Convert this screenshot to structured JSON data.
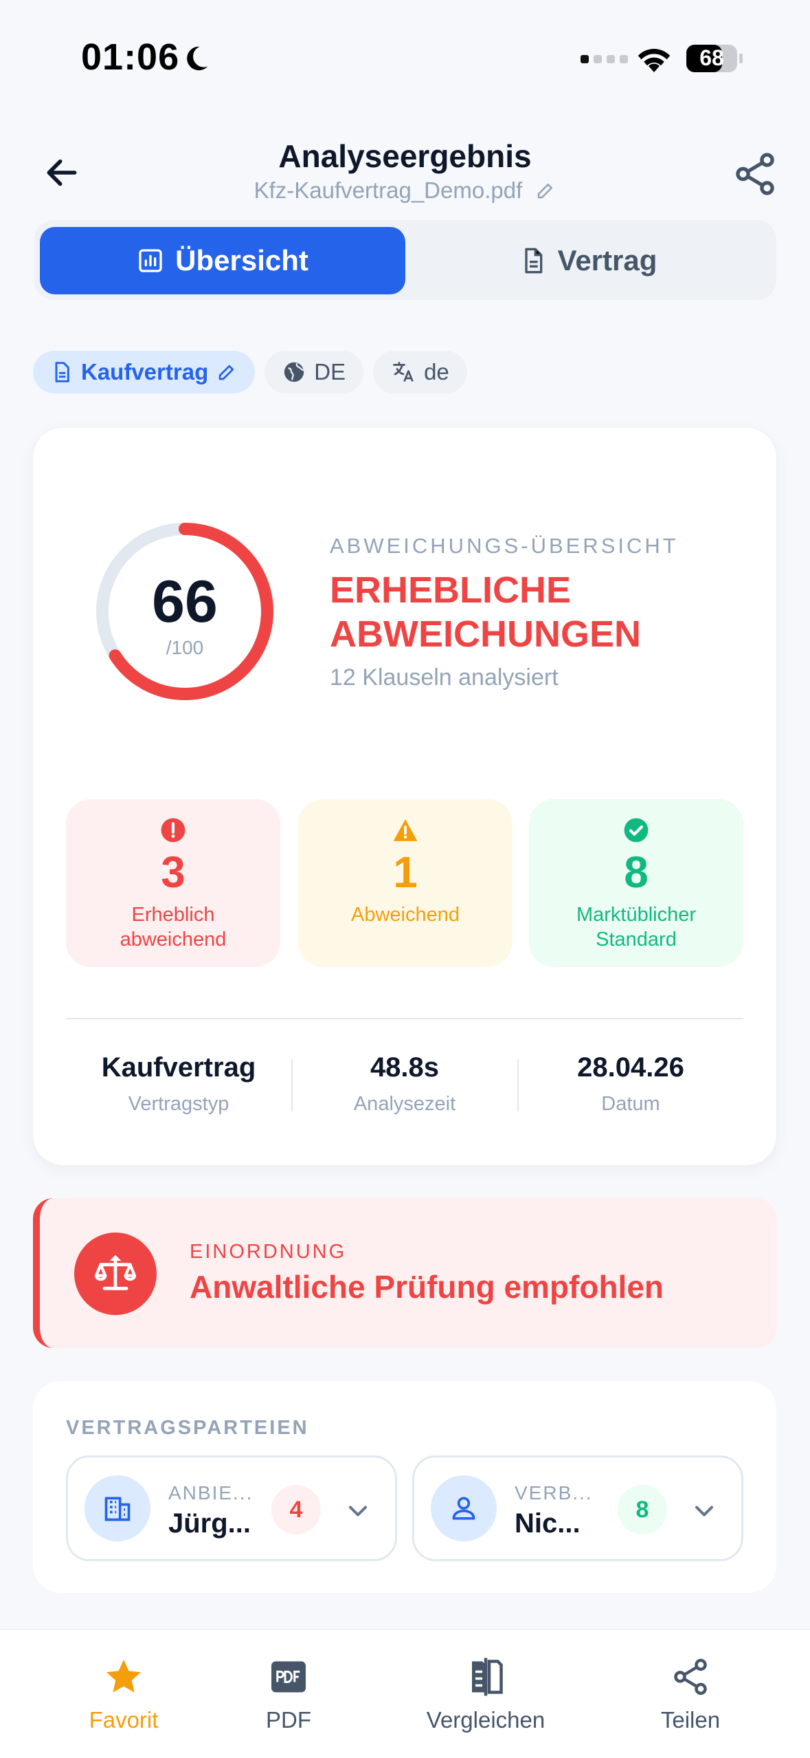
{
  "status_bar": {
    "time": "01:06",
    "battery": "68"
  },
  "header": {
    "title": "Analyseergebnis",
    "filename": "Kfz-Kaufvertrag_Demo.pdf"
  },
  "tabs": [
    {
      "label": "Übersicht"
    },
    {
      "label": "Vertrag"
    }
  ],
  "chips": {
    "type": "Kaufvertrag",
    "country": "DE",
    "language": "de"
  },
  "score": {
    "value": 66,
    "denominator": "/100",
    "fraction": 0.66,
    "color": "#EF4444"
  },
  "overview": {
    "label": "ABWEICHUNGS-ÜBERSICHT",
    "title": "ERHEBLICHE ABWEICHUNGEN",
    "subtitle": "12 Klauseln analysiert"
  },
  "stats": [
    {
      "value": "3",
      "label": "Erheblich abweichend",
      "color": "#EF4444"
    },
    {
      "value": "1",
      "label": "Abweichend",
      "color": "#F59E0B"
    },
    {
      "value": "8",
      "label": "Marktüblicher Standard",
      "color": "#10B981"
    }
  ],
  "meta": [
    {
      "value": "Kaufvertrag",
      "label": "Vertragstyp"
    },
    {
      "value": "48.8s",
      "label": "Analysezeit"
    },
    {
      "value": "28.04.26",
      "label": "Datum"
    }
  ],
  "einordnung": {
    "label": "EINORDNUNG",
    "title": "Anwaltliche Prüfung empfohlen"
  },
  "parties": {
    "label": "VERTRAGSPARTEIEN",
    "items": [
      {
        "role": "ANBIE...",
        "name": "Jürg...",
        "count": "4"
      },
      {
        "role": "VERB...",
        "name": "Nic...",
        "count": "8"
      }
    ]
  },
  "bottom_nav": [
    {
      "label": "Favorit"
    },
    {
      "label": "PDF"
    },
    {
      "label": "Vergleichen"
    },
    {
      "label": "Teilen"
    }
  ]
}
